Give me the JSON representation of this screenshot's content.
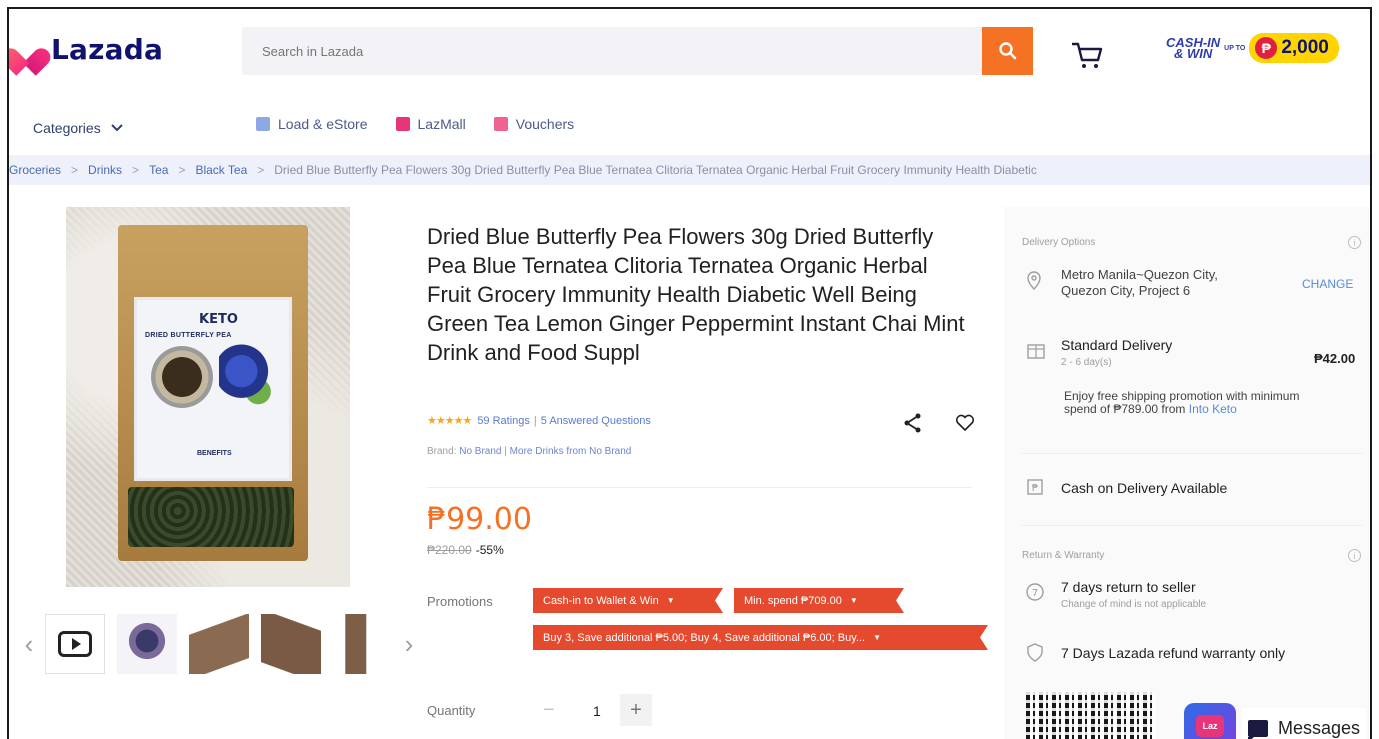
{
  "header": {
    "logo_text": "Lazada",
    "search_placeholder": "Search in Lazada",
    "promo_line1": "CASH-IN",
    "promo_line2": "& WIN",
    "promo_upto": "UP TO",
    "promo_currency": "₱",
    "promo_amount": "2,000"
  },
  "subnav": {
    "categories_label": "Categories",
    "links": [
      {
        "label": "Load & eStore",
        "color": "#6c8ad8"
      },
      {
        "label": "LazMall",
        "color": "#e8357a"
      },
      {
        "label": "Vouchers",
        "color": "#e8357a"
      }
    ]
  },
  "breadcrumb": {
    "items": [
      "Groceries",
      "Drinks",
      "Tea",
      "Black Tea"
    ],
    "current": "Dried Blue Butterfly Pea Flowers 30g Dried Butterfly Pea Blue Ternatea Clitoria Ternatea Organic Herbal Fruit Grocery Immunity Health Diabetic"
  },
  "product": {
    "title": "Dried Blue Butterfly Pea Flowers 30g Dried Butterfly Pea Blue Ternatea Clitoria Ternatea Organic Herbal Fruit Grocery Immunity Health Diabetic Well Being Green Tea Lemon Ginger Peppermint Instant Chai Mint Drink and Food Suppl",
    "image_brand": "KETO",
    "image_label": "DRIED BUTTERFLY PEA",
    "image_benefits": "BENEFITS",
    "stars": "★★★★★",
    "ratings_text": "59 Ratings",
    "questions_text": "5 Answered Questions",
    "brand_prefix": "Brand:",
    "brand_name": "No Brand",
    "more_from": "More Drinks from No Brand",
    "price": "₱99.00",
    "original_price": "₱220.00",
    "discount": "-55%",
    "promotions_label": "Promotions",
    "promo_tags": [
      "Cash-in to Wallet & Win",
      "Min. spend ₱709.00",
      "Buy 3, Save additional ₱5.00; Buy 4, Save additional ₱6.00; Buy..."
    ],
    "quantity_label": "Quantity",
    "quantity_value": "1"
  },
  "delivery": {
    "section_title": "Delivery Options",
    "location": "Metro Manila~Quezon City, Quezon City, Project 6",
    "change_label": "CHANGE",
    "standard_title": "Standard Delivery",
    "standard_days": "2 - 6 day(s)",
    "standard_price": "₱42.00",
    "free_shipping_text": "Enjoy free shipping promotion with minimum spend of ₱789.00 from",
    "free_shipping_store": "Into Keto",
    "cod_text": "Cash on Delivery Available"
  },
  "warranty": {
    "section_title": "Return & Warranty",
    "return_title": "7 days return to seller",
    "return_sub": "Change of mind is not applicable",
    "warranty_text": "7 Days Lazada refund warranty only"
  },
  "chat": {
    "app_label": "Laz",
    "messages_label": "Messages"
  }
}
